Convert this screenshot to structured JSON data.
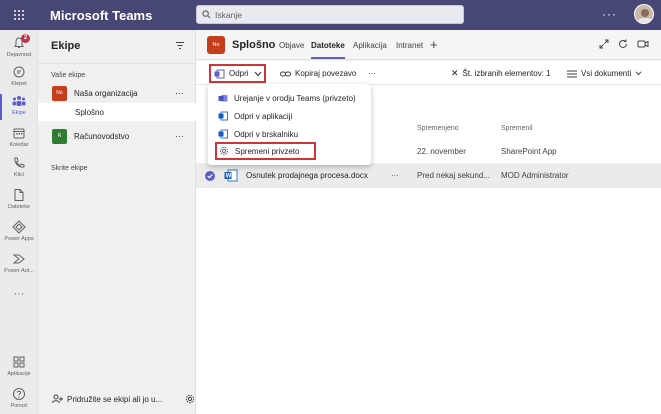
{
  "app": {
    "title": "Microsoft Teams"
  },
  "search": {
    "placeholder": "Iskanje"
  },
  "topbar": {
    "more": "···"
  },
  "rail": {
    "items": [
      {
        "label": "Dejavnost",
        "badge": "2"
      },
      {
        "label": "Klepet"
      },
      {
        "label": "Ekipe"
      },
      {
        "label": "Koledar"
      },
      {
        "label": "Klici"
      },
      {
        "label": "Datoteke"
      },
      {
        "label": "Power Apps"
      },
      {
        "label": "Power Aut..."
      },
      {
        "label": "···"
      },
      {
        "label": "Aplikacije"
      },
      {
        "label": "Pomoč"
      }
    ]
  },
  "panel": {
    "title": "Ekipe",
    "section_label": "Vaše ekipe",
    "teams": [
      {
        "initials": "No",
        "name": "Naša organizacija",
        "color": "#c43e1c"
      },
      {
        "initials": "R",
        "name": "Računovodstvo",
        "color": "#2e7d32"
      }
    ],
    "channel": "Splošno",
    "hidden_label": "Skrite ekipe",
    "join_label": "Pridružite se ekipi ali jo u..."
  },
  "channel_header": {
    "initials": "No",
    "name": "Splošno",
    "tabs": [
      "Objave",
      "Datoteke",
      "Aplikacija",
      "Intranet"
    ]
  },
  "toolbar": {
    "open_label": "Odpri",
    "copy_link": "Kopiraj povezavo",
    "more": "···",
    "selected": "Št. izbranih elementov: 1",
    "view": "Vsi dokumenti"
  },
  "open_menu": {
    "items": [
      "Urejanje v orodju Teams (privzeto)",
      "Odpri v aplikaciji",
      "Odpri v brskalniku",
      "Spremeni privzeto"
    ]
  },
  "files": {
    "columns": {
      "modified": "Spremenjeno",
      "modified_by": "Spremenil"
    },
    "rows": [
      {
        "name": "",
        "modified": "22. november",
        "modified_by": "SharePoint App"
      },
      {
        "name": "Osnutek prodajnega procesa.docx",
        "modified": "Pred nekaj sekund...",
        "modified_by": "MOD Administrator",
        "more": "···"
      }
    ]
  },
  "colors": {
    "brand": "#464775",
    "accent": "#5b5fc7",
    "highlight": "#d13438"
  }
}
